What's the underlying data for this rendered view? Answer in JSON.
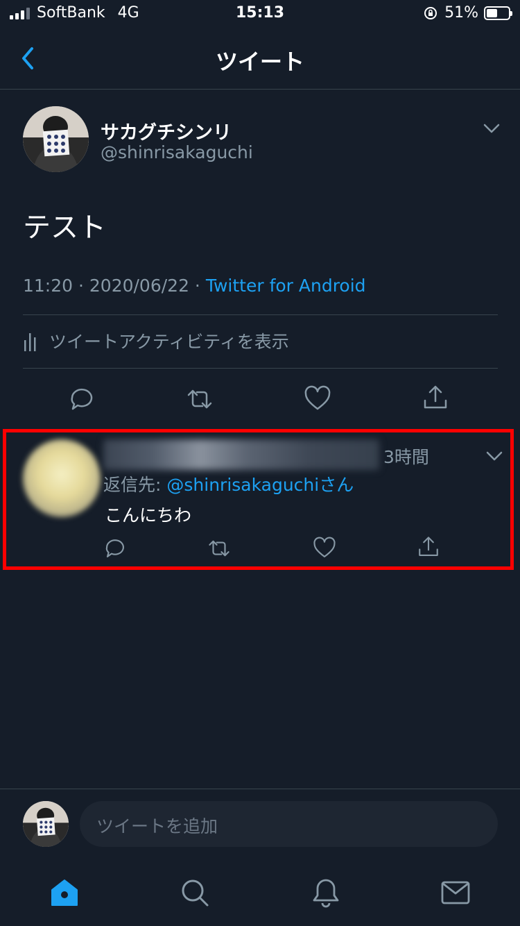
{
  "status_bar": {
    "carrier": "SoftBank",
    "network": "4G",
    "time": "15:13",
    "battery_percent": "51%",
    "battery_level": 0.51
  },
  "nav": {
    "title": "ツイート",
    "back_icon": "chevron-left-icon"
  },
  "tweet": {
    "author_name": "サカグチシンリ",
    "author_handle": "@shinrisakaguchi",
    "text": "テスト",
    "timestamp": "11:20 · 2020/06/22 · ",
    "source": "Twitter for Android",
    "activity_label": "ツイートアクティビティを表示"
  },
  "reply": {
    "time": "3時間",
    "reply_to_label": "返信先: ",
    "reply_to_handle": "@shinrisakaguchiさん",
    "text": "こんにちわ"
  },
  "composer": {
    "placeholder": "ツイートを追加"
  },
  "colors": {
    "background": "#151d29",
    "accent": "#1da1f2",
    "secondary_text": "#8899a6",
    "highlight_border": "#ff0000"
  },
  "icons": [
    "reply-icon",
    "retweet-icon",
    "like-icon",
    "share-icon",
    "home-icon",
    "search-icon",
    "notifications-icon",
    "messages-icon"
  ]
}
